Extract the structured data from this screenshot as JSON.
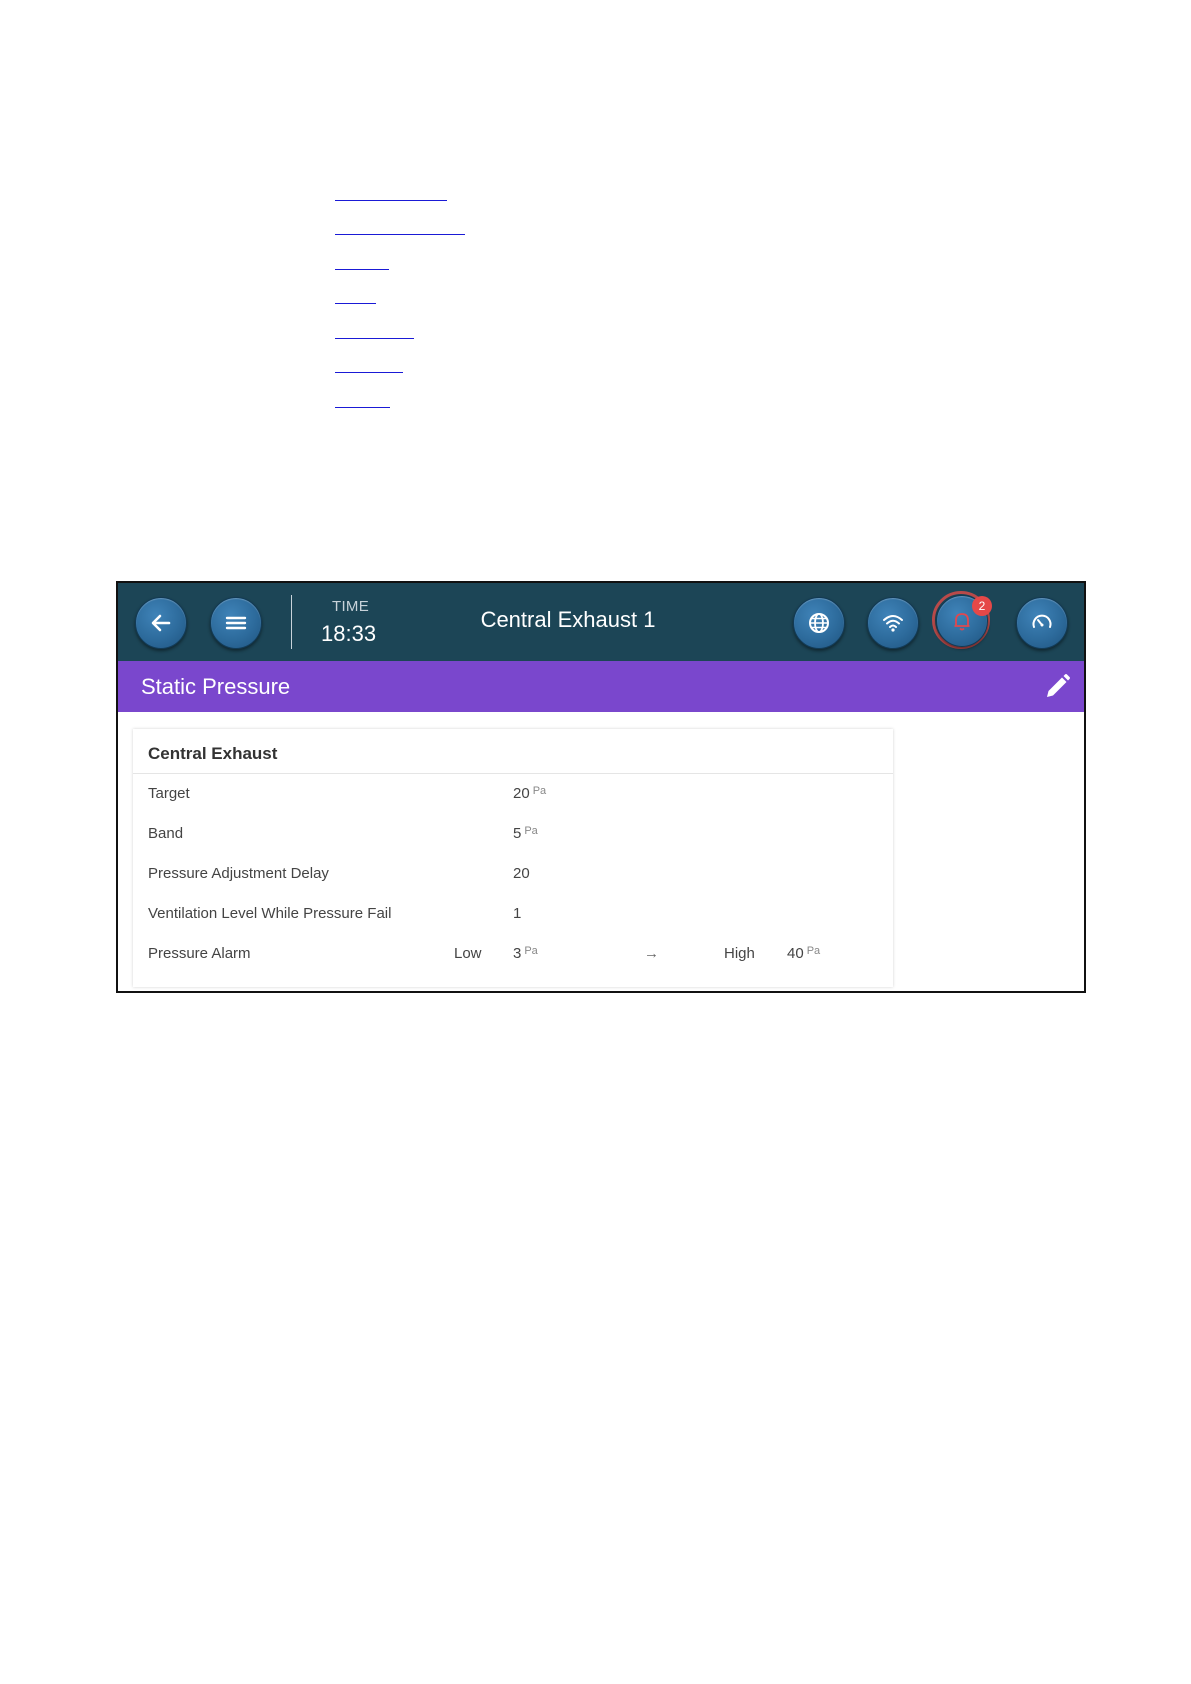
{
  "header": {
    "time_label": "TIME",
    "time_value": "18:33",
    "title": "Central Exhaust 1",
    "alarm_count": "2",
    "icons": [
      "back-arrow-icon",
      "menu-icon",
      "globe-icon",
      "wifi-icon",
      "bell-icon",
      "gauge-icon"
    ]
  },
  "section": {
    "title": "Static Pressure",
    "edit_icon": "pencil-icon"
  },
  "card": {
    "title": "Central Exhaust",
    "rows": [
      {
        "label": "Target",
        "value": "20",
        "unit": "Pa"
      },
      {
        "label": "Band",
        "value": "5",
        "unit": "Pa"
      },
      {
        "label": "Pressure Adjustment Delay",
        "value": "20",
        "unit": ""
      },
      {
        "label": "Ventilation Level While Pressure Fail",
        "value": "1",
        "unit": ""
      }
    ],
    "alarm": {
      "label": "Pressure Alarm",
      "low_label": "Low",
      "low_value": "3",
      "low_unit": "Pa",
      "arrow": "→",
      "high_label": "High",
      "high_value": "40",
      "high_unit": "Pa"
    }
  },
  "colors": {
    "topbar": "#1c4556",
    "section_bar": "#7a47cd",
    "button": "#2d6b9c",
    "badge": "#e54848",
    "link": "#1a1ad6"
  }
}
